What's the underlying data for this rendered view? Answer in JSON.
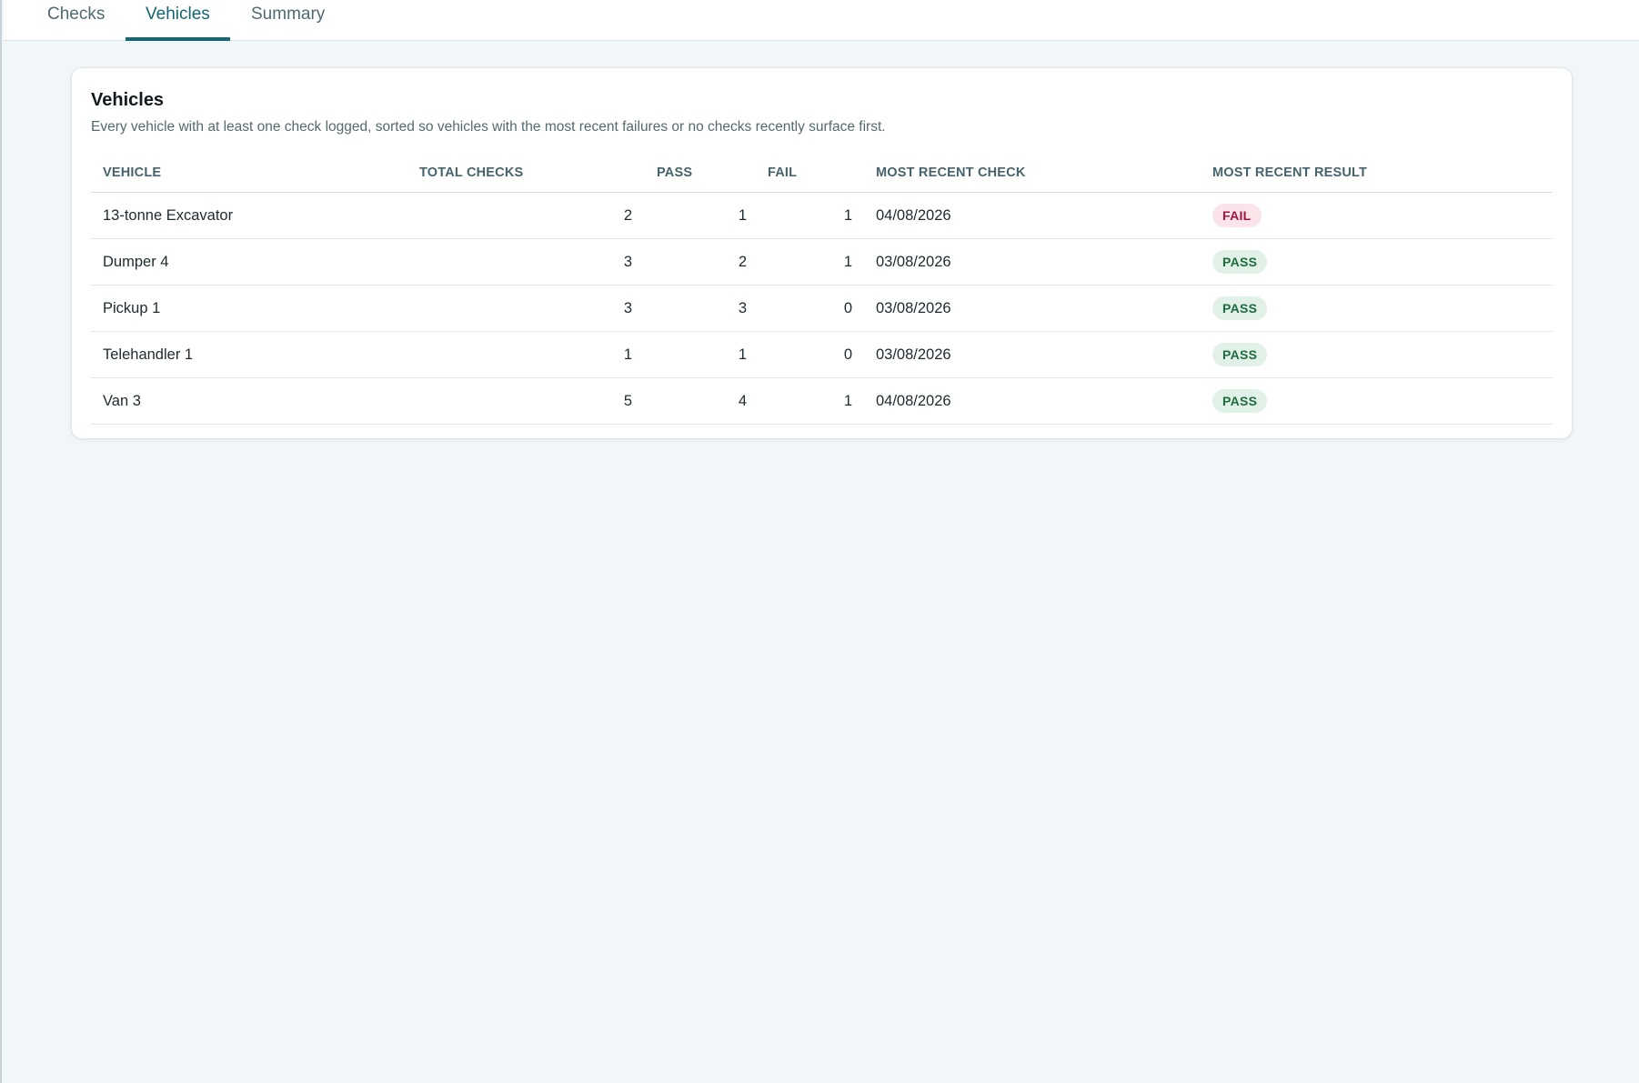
{
  "tabs": [
    {
      "label": "Checks",
      "active": false
    },
    {
      "label": "Vehicles",
      "active": true
    },
    {
      "label": "Summary",
      "active": false
    }
  ],
  "card": {
    "title": "Vehicles",
    "subtitle": "Every vehicle with at least one check logged, sorted so vehicles with the most recent failures or no checks recently surface first."
  },
  "table": {
    "columns": [
      "VEHICLE",
      "TOTAL CHECKS",
      "PASS",
      "FAIL",
      "MOST RECENT CHECK",
      "MOST RECENT RESULT"
    ],
    "rows": [
      {
        "vehicle": "13-tonne Excavator",
        "total": "2",
        "pass": "1",
        "fail": "1",
        "recent_check": "04/08/2026",
        "result": "FAIL"
      },
      {
        "vehicle": "Dumper 4",
        "total": "3",
        "pass": "2",
        "fail": "1",
        "recent_check": "03/08/2026",
        "result": "PASS"
      },
      {
        "vehicle": "Pickup 1",
        "total": "3",
        "pass": "3",
        "fail": "0",
        "recent_check": "03/08/2026",
        "result": "PASS"
      },
      {
        "vehicle": "Telehandler 1",
        "total": "1",
        "pass": "1",
        "fail": "0",
        "recent_check": "03/08/2026",
        "result": "PASS"
      },
      {
        "vehicle": "Van 3",
        "total": "5",
        "pass": "4",
        "fail": "1",
        "recent_check": "04/08/2026",
        "result": "PASS"
      }
    ]
  },
  "colors": {
    "accent": "#136673",
    "fail_bg": "#fbe3ea",
    "fail_text": "#a2143f",
    "pass_bg": "#e1f1e8",
    "pass_text": "#1e6b3e",
    "page_bg": "#f1f6f8"
  }
}
